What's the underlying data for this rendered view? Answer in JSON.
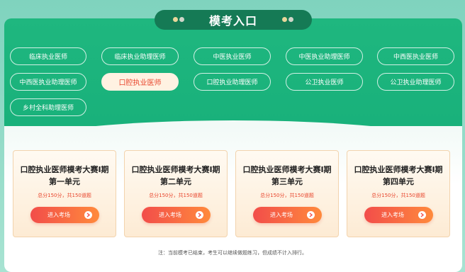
{
  "header": {
    "title": "模考入口"
  },
  "categories": [
    {
      "label": "临床执业医师",
      "active": false
    },
    {
      "label": "临床执业助理医师",
      "active": false
    },
    {
      "label": "中医执业医师",
      "active": false
    },
    {
      "label": "中医执业助理医师",
      "active": false
    },
    {
      "label": "中西医执业医师",
      "active": false
    },
    {
      "label": "中西医执业助理医师",
      "active": false
    },
    {
      "label": "口腔执业医师",
      "active": true
    },
    {
      "label": "口腔执业助理医师",
      "active": false
    },
    {
      "label": "公卫执业医师",
      "active": false
    },
    {
      "label": "公卫执业助理医师",
      "active": false
    },
    {
      "label": "乡村全科助理医师",
      "active": false
    }
  ],
  "cards": [
    {
      "title_line1": "口腔执业医师模考大赛Ⅰ期",
      "title_line2": "第一单元",
      "sub": "总分150分，共150道题",
      "button": "进入考场"
    },
    {
      "title_line1": "口腔执业医师模考大赛Ⅰ期",
      "title_line2": "第二单元",
      "sub": "总分150分，共150道题",
      "button": "进入考场"
    },
    {
      "title_line1": "口腔执业医师模考大赛Ⅰ期",
      "title_line2": "第三单元",
      "sub": "总分150分，共150道题",
      "button": "进入考场"
    },
    {
      "title_line1": "口腔执业医师模考大赛Ⅰ期",
      "title_line2": "第四单元",
      "sub": "总分150分，共150道题",
      "button": "进入考场"
    }
  ],
  "footer": {
    "note": "注：当前模考已结束，考生可以继续做题练习，但成绩不计入排行。"
  },
  "colors": {
    "primary_green": "#1fb77f",
    "title_tab": "#157a55",
    "accent_red": "#e8452c",
    "button_start": "#f24d4a",
    "button_end": "#ff8a3c"
  },
  "icons": {
    "enter_arrow": "chevron-right-circle-icon"
  }
}
